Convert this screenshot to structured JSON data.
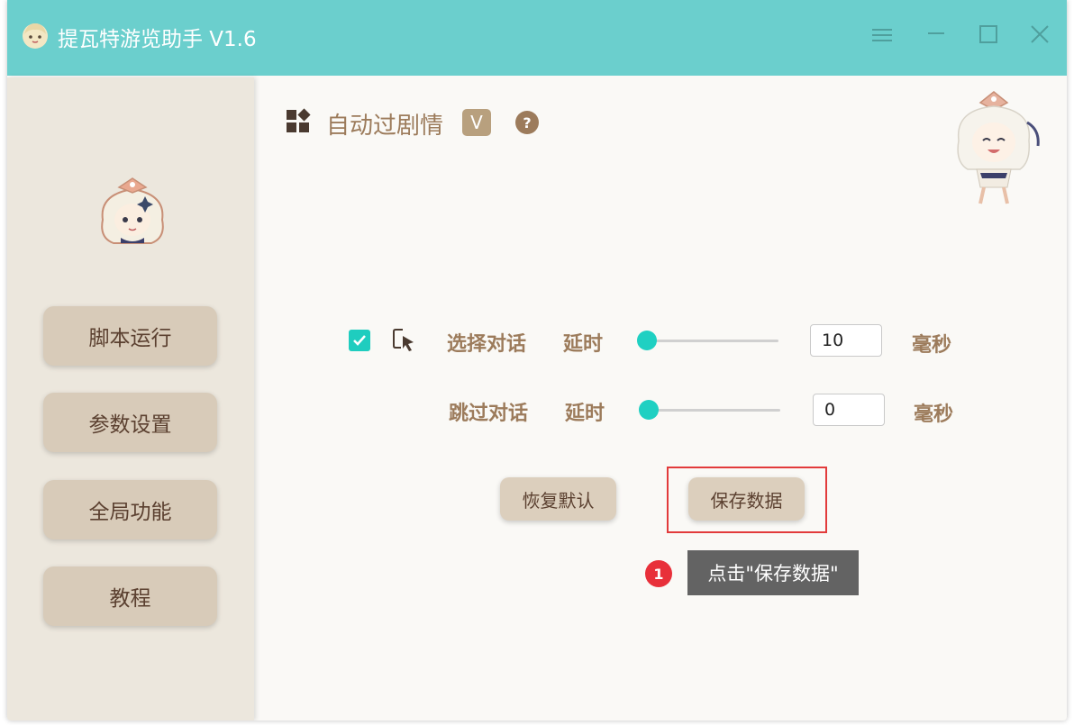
{
  "window": {
    "title": "提瓦特游览助手 V1.6",
    "accent_color": "#6bcfcd",
    "controls": [
      "menu-icon",
      "minimize-icon",
      "maximize-icon",
      "close-icon"
    ]
  },
  "sidebar": {
    "items": [
      {
        "label": "脚本运行"
      },
      {
        "label": "参数设置"
      },
      {
        "label": "全局功能"
      },
      {
        "label": "教程"
      }
    ]
  },
  "main": {
    "mode_title": "自动过剧情",
    "hotkey_badge": "V",
    "help_label": "?",
    "rows": [
      {
        "checked": true,
        "name": "选择对话",
        "delay_label": "延时",
        "value": "10",
        "unit": "毫秒",
        "slider_level": 0
      },
      {
        "name": "跳过对话",
        "delay_label": "延时",
        "value": "0",
        "unit": "毫秒",
        "slider_level": 0
      }
    ],
    "buttons": {
      "reset": "恢复默认",
      "save": "保存数据"
    }
  },
  "annotation": {
    "step_number": "1",
    "tooltip": "点击\"保存数据\"",
    "highlight_color": "#e23b3b"
  }
}
